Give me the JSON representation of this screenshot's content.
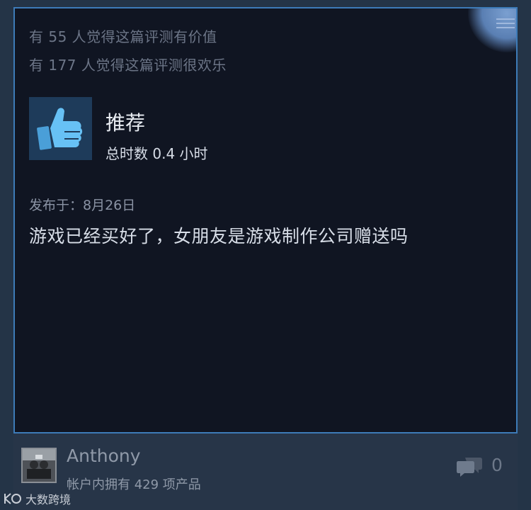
{
  "review": {
    "helpful_line": "有 55 人觉得这篇评测有价值",
    "funny_line": "有 177 人觉得这篇评测很欢乐",
    "recommendation": "推荐",
    "playtime": "总时数 0.4 小时",
    "posted": "发布于：8月26日",
    "body": "游戏已经买好了，女朋友是游戏制作公司赠送吗"
  },
  "author": {
    "name": "Anthony",
    "products": "帐户内拥有 429 项产品"
  },
  "comments": {
    "count": "0"
  },
  "watermark": {
    "text": "大数跨境"
  },
  "icons": {
    "recommend": "thumbs-up-icon",
    "comments": "speech-bubble-icon",
    "menu": "menu-icon"
  },
  "colors": {
    "card_background": "#101522",
    "card_border": "#3d7bb8",
    "footer_background": "#273548",
    "thumb_background": "#1e3b5a",
    "thumb_icon": "#67c1f5"
  }
}
